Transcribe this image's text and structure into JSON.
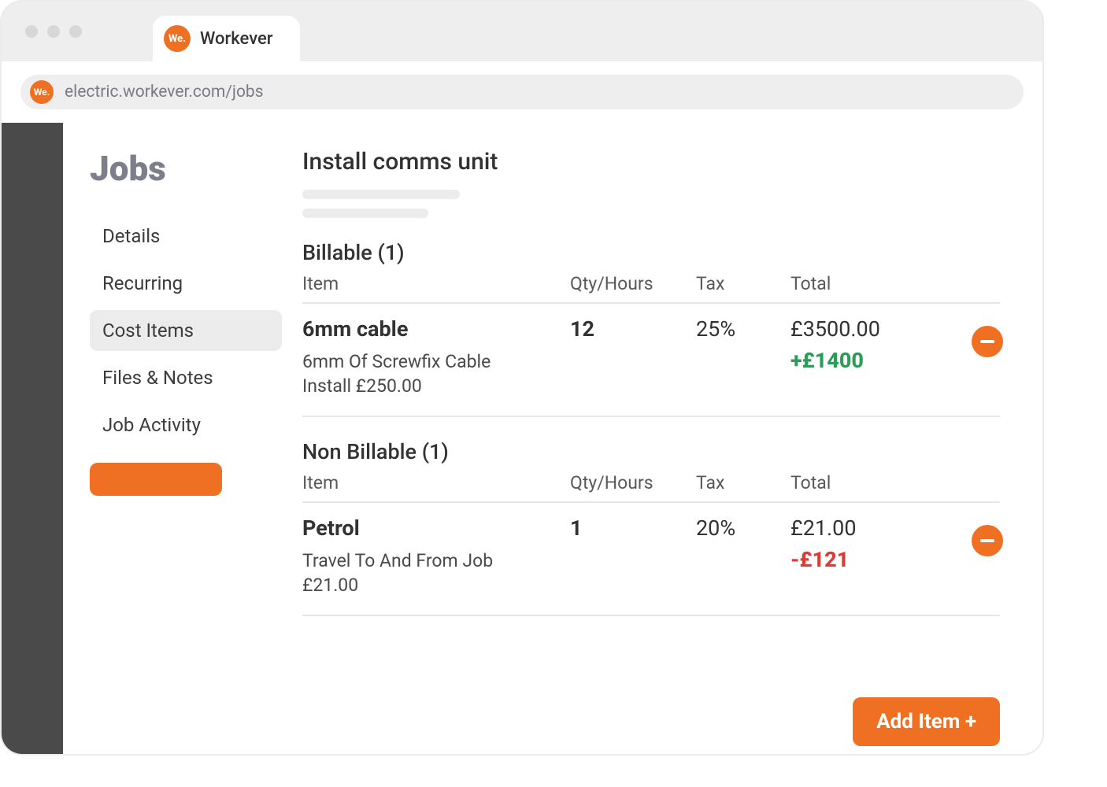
{
  "browser": {
    "tab_label": "Workever",
    "brand_short": "We.",
    "url": "electric.workever.com/jobs"
  },
  "sidebar": {
    "title": "Jobs",
    "items": [
      {
        "label": "Details"
      },
      {
        "label": "Recurring"
      },
      {
        "label": "Cost Items",
        "active": true
      },
      {
        "label": "Files & Notes"
      },
      {
        "label": "Job Activity"
      }
    ]
  },
  "main": {
    "job_title": "Install comms unit",
    "columns": {
      "item": "Item",
      "qty": "Qty/Hours",
      "tax": "Tax",
      "total": "Total"
    },
    "billable": {
      "title": "Billable (1)",
      "rows": [
        {
          "name": "6mm cable",
          "desc": "6mm Of Screwfix Cable Install £250.00",
          "qty": "12",
          "tax": "25%",
          "total": "£3500.00",
          "delta": "+£1400",
          "delta_sign": "pos"
        }
      ]
    },
    "non_billable": {
      "title": "Non Billable (1)",
      "rows": [
        {
          "name": "Petrol",
          "desc": "Travel To And From Job £21.00",
          "qty": "1",
          "tax": "20%",
          "total": "£21.00",
          "delta": "-£121",
          "delta_sign": "neg"
        }
      ]
    },
    "add_item_label": "Add Item +"
  }
}
